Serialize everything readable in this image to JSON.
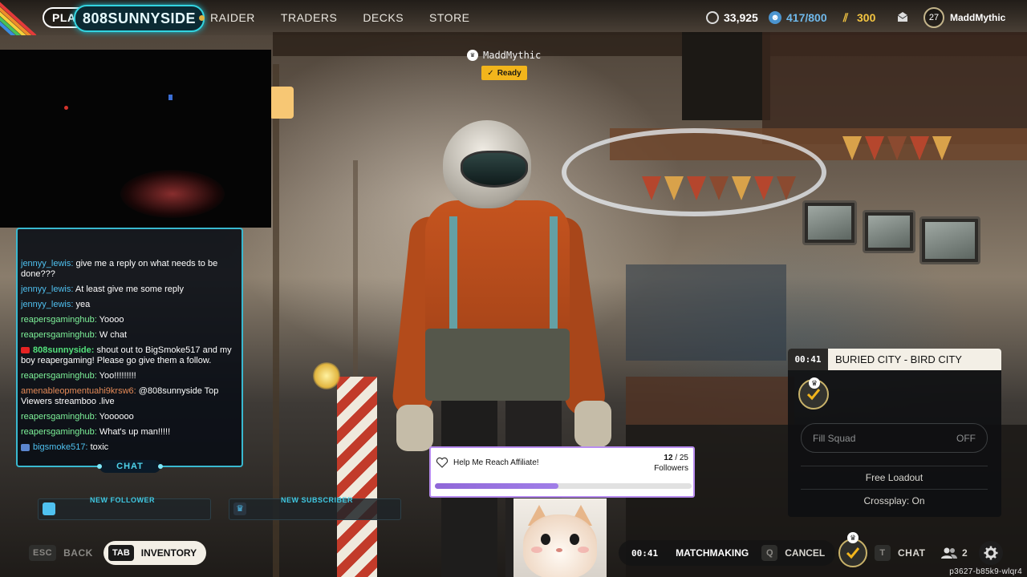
{
  "nav": {
    "play_label": "PLAY",
    "streamer_name": "808SUNNYSIDE",
    "items": [
      {
        "label": "RAIDER"
      },
      {
        "label": "TRADERS"
      },
      {
        "label": "DECKS"
      },
      {
        "label": "STORE"
      }
    ]
  },
  "currency": {
    "coins": "33,925",
    "raider_tokens": "417/800",
    "cred": "300"
  },
  "user": {
    "level": "27",
    "name": "MaddMythic"
  },
  "player_tag": {
    "name": "MaddMythic",
    "status": "Ready"
  },
  "chat": {
    "tab_label": "CHAT",
    "messages": [
      {
        "user": "jennyy_lewis:",
        "text": "give me a reply on what needs to be done???",
        "style": "blue"
      },
      {
        "user": "jennyy_lewis:",
        "text": "At least give me some reply",
        "style": "blue"
      },
      {
        "user": "jennyy_lewis:",
        "text": "yea",
        "style": "blue"
      },
      {
        "user": "reapersgaminghub:",
        "text": "Yoooo",
        "style": "green"
      },
      {
        "user": "reapersgaminghub:",
        "text": "W chat",
        "style": "green"
      },
      {
        "user": "808sunnyside:",
        "text": "shout out to BigSmoke517 and my boy reapergaming! Please go give them a follow.",
        "style": "self"
      },
      {
        "user": "reapersgaminghub:",
        "text": "Yoo!!!!!!!!!",
        "style": "green"
      },
      {
        "user": "amenableopmentuahi9krsw6:",
        "text": "@808sunnyside Top Viewers streamboo .live",
        "style": "orange"
      },
      {
        "user": "reapersgaminghub:",
        "text": "Yoooooo",
        "style": "green"
      },
      {
        "user": "reapersgaminghub:",
        "text": "What's up man!!!!!",
        "style": "green"
      },
      {
        "user": "bigsmoke517:",
        "text": "toxic",
        "style": "fb"
      }
    ]
  },
  "alerts": {
    "new_follower_label": "NEW FOLLOWER",
    "new_subscriber_label": "NEW SUBSCRIBER"
  },
  "goal": {
    "title": "Help Me Reach Affiliate!",
    "current": "12",
    "target": "/ 25",
    "unit": "Followers",
    "progress": 0.48
  },
  "squad": {
    "timer": "00:41",
    "map": "BURIED CITY - BIRD CITY",
    "fill_label": "Fill Squad",
    "fill_value": "OFF",
    "loadout": "Free Loadout",
    "crossplay": "Crossplay: On"
  },
  "bottom": {
    "esc_key": "ESC",
    "back_label": "BACK",
    "tab_key": "TAB",
    "inventory_label": "INVENTORY",
    "match_timer": "00:41",
    "matchmaking_label": "MATCHMAKING",
    "cancel_key": "Q",
    "cancel_label": "CANCEL",
    "chat_key": "T",
    "chat_label": "CHAT",
    "party_count": "2"
  },
  "session_id": "p3627-b85k9-wlqr4",
  "colors": {
    "accent_cyan": "#39b9d0",
    "ready_yellow": "#f2b51c",
    "goal_purple": "#8f67d8"
  }
}
